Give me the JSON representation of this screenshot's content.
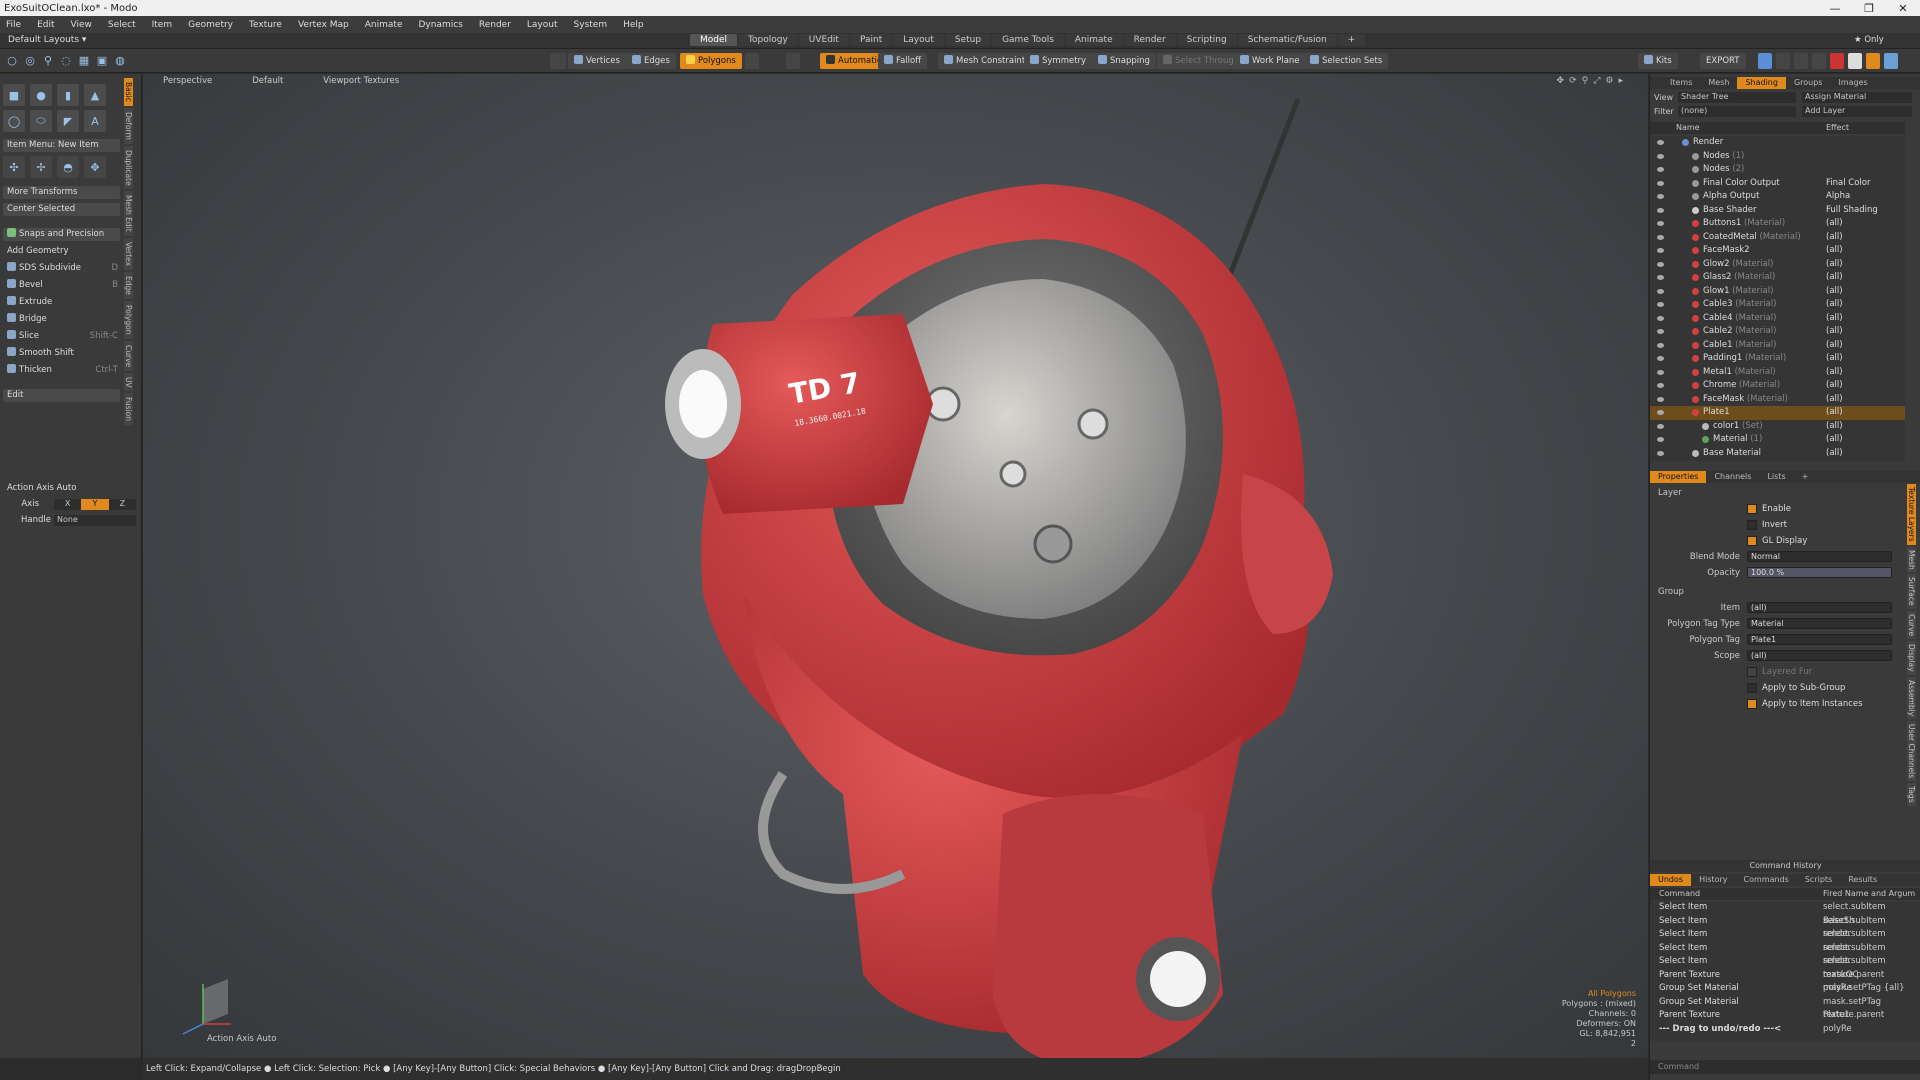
{
  "window": {
    "title": "ExoSuitOClean.lxo* - Modo",
    "controls": [
      "—",
      "❐",
      "✕"
    ]
  },
  "menu": [
    "File",
    "Edit",
    "View",
    "Select",
    "Item",
    "Geometry",
    "Texture",
    "Vertex Map",
    "Animate",
    "Dynamics",
    "Render",
    "Layout",
    "System",
    "Help"
  ],
  "layout": {
    "name": "Default Layouts ▾",
    "tabs": [
      "Model",
      "Topology",
      "UVEdit",
      "Paint",
      "Layout",
      "Setup",
      "Game Tools",
      "Animate",
      "Render",
      "Scripting",
      "Schematic/Fusion"
    ],
    "active": "Model",
    "plus": "+",
    "only_label": "★ Only"
  },
  "toolbar": {
    "vertices": "Vertices",
    "edges": "Edges",
    "polygons": "Polygons",
    "automatic": "Automatic",
    "falloff": "Falloff",
    "mesh_constraint": "Mesh Constraint",
    "symmetry": "Symmetry",
    "snapping": "Snapping",
    "select_through": "Select Through",
    "work_plane": "Work Plane",
    "selection_sets": "Selection Sets",
    "kits": "Kits",
    "export": "EXPORT"
  },
  "left": {
    "item_menu": "Item Menu: New Item",
    "more_transforms": "More Transforms",
    "center_selected": "Center Selected",
    "snaps": "Snaps and Precision",
    "add_geometry": "Add Geometry",
    "tools": [
      {
        "label": "SDS Subdivide",
        "key": "D"
      },
      {
        "label": "Bevel",
        "key": "B"
      },
      {
        "label": "Extrude",
        "key": ""
      },
      {
        "label": "Bridge",
        "key": ""
      },
      {
        "label": "Slice",
        "key": "Shift-C"
      },
      {
        "label": "Smooth Shift",
        "key": ""
      },
      {
        "label": "Thicken",
        "key": "Ctrl-T"
      }
    ],
    "edit": "Edit",
    "action_axis": "Action Axis Auto",
    "axis_label": "Axis",
    "axis_x": "X",
    "axis_y": "Y",
    "axis_z": "Z",
    "handle_label": "Handle",
    "handle_value": "None",
    "vtabs": [
      "Basic",
      "Deform",
      "Duplicate",
      "Mesh Edit",
      "Vertex",
      "Edge",
      "Polygon",
      "Curve",
      "UV",
      "Fusion"
    ]
  },
  "viewport": {
    "perspective": "Perspective",
    "shading": "Default",
    "textures": "Viewport Textures",
    "axis_label": "Action Axis Auto",
    "label_td7": "TD 7",
    "label_serial": "18.3660.0021.18",
    "info": {
      "selection": "All Polygons",
      "polygons": "Polygons : (mixed)",
      "channels": "Channels: 0",
      "deformers": "Deformers: ON",
      "gl": "GL: 8,842,951",
      "page": "2"
    }
  },
  "status": "Left Click: Expand/Collapse ● Left Click: Selection: Pick ● [Any Key]-[Any Button] Click: Special Behaviors ● [Any Key]-[Any Button] Click and Drag: dragDropBegin",
  "right": {
    "tabs": [
      "Items",
      "Mesh",
      "Shading",
      "Groups",
      "Images"
    ],
    "active": "Shading",
    "view_label": "View",
    "view_value": "Shader Tree",
    "assign": "Assign Material",
    "filter_label": "Filter",
    "filter_value": "(none)",
    "add_layer": "Add Layer",
    "col_name": "Name",
    "col_effect": "Effect",
    "tree": [
      {
        "name": "Render",
        "type": "",
        "effect": "",
        "indent": 0,
        "dot": "#6f8fcf"
      },
      {
        "name": "Nodes",
        "type": "(1)",
        "effect": "",
        "indent": 1,
        "dot": "#999"
      },
      {
        "name": "Nodes",
        "type": "(2)",
        "effect": "",
        "indent": 1,
        "dot": "#999"
      },
      {
        "name": "Final Color Output",
        "type": "",
        "effect": "Final Color",
        "indent": 1,
        "dot": "#999"
      },
      {
        "name": "Alpha Output",
        "type": "",
        "effect": "Alpha",
        "indent": 1,
        "dot": "#999"
      },
      {
        "name": "Base Shader",
        "type": "",
        "effect": "Full Shading",
        "indent": 1,
        "dot": "#ccc"
      },
      {
        "name": "Buttons1",
        "type": "(Material)",
        "effect": "(all)",
        "indent": 1,
        "dot": "#d24040"
      },
      {
        "name": "CoatedMetal",
        "type": "(Material)",
        "effect": "(all)",
        "indent": 1,
        "dot": "#d24040"
      },
      {
        "name": "FaceMask2",
        "type": "",
        "effect": "(all)",
        "indent": 1,
        "dot": "#d24040"
      },
      {
        "name": "Glow2",
        "type": "(Material)",
        "effect": "(all)",
        "indent": 1,
        "dot": "#d24040"
      },
      {
        "name": "Glass2",
        "type": "(Material)",
        "effect": "(all)",
        "indent": 1,
        "dot": "#d24040"
      },
      {
        "name": "Glow1",
        "type": "(Material)",
        "effect": "(all)",
        "indent": 1,
        "dot": "#d24040"
      },
      {
        "name": "Cable3",
        "type": "(Material)",
        "effect": "(all)",
        "indent": 1,
        "dot": "#d24040"
      },
      {
        "name": "Cable4",
        "type": "(Material)",
        "effect": "(all)",
        "indent": 1,
        "dot": "#d24040"
      },
      {
        "name": "Cable2",
        "type": "(Material)",
        "effect": "(all)",
        "indent": 1,
        "dot": "#d24040"
      },
      {
        "name": "Cable1",
        "type": "(Material)",
        "effect": "(all)",
        "indent": 1,
        "dot": "#d24040"
      },
      {
        "name": "Padding1",
        "type": "(Material)",
        "effect": "(all)",
        "indent": 1,
        "dot": "#d24040"
      },
      {
        "name": "Metal1",
        "type": "(Material)",
        "effect": "(all)",
        "indent": 1,
        "dot": "#d24040"
      },
      {
        "name": "Chrome",
        "type": "(Material)",
        "effect": "(all)",
        "indent": 1,
        "dot": "#d24040"
      },
      {
        "name": "FaceMask",
        "type": "(Material)",
        "effect": "(all)",
        "indent": 1,
        "dot": "#d24040"
      },
      {
        "name": "Plate1",
        "type": "",
        "effect": "(all)",
        "indent": 1,
        "dot": "#d24040",
        "selected": true
      },
      {
        "name": "color1",
        "type": "(Set)",
        "effect": "(all)",
        "indent": 2,
        "dot": "#bbb"
      },
      {
        "name": "Material",
        "type": "(1)",
        "effect": "(all)",
        "indent": 2,
        "dot": "#5aa55a"
      },
      {
        "name": "Base Material",
        "type": "",
        "effect": "(all)",
        "indent": 1,
        "dot": "#bbb"
      }
    ],
    "props_tabs": [
      "Properties",
      "Channels",
      "Lists",
      "+"
    ],
    "layer_section": "Layer",
    "enable": "Enable",
    "invert": "Invert",
    "gl_display": "GL Display",
    "blend_label": "Blend Mode",
    "blend_value": "Normal",
    "opacity_label": "Opacity",
    "opacity_value": "100.0 %",
    "group_section": "Group",
    "item_label": "Item",
    "item_value": "(all)",
    "ptt_label": "Polygon Tag Type",
    "ptt_value": "Material",
    "pt_label": "Polygon Tag",
    "pt_value": "Plate1",
    "scope_label": "Scope",
    "scope_value": "(all)",
    "layered_fur": "Layered Fur",
    "apply_sub": "Apply to Sub-Group",
    "apply_inst": "Apply to Item Instances",
    "side_tabs": [
      "Texture Layers",
      "Mesh",
      "Surface",
      "Curve",
      "Display",
      "Assembly",
      "User Channels",
      "Tags"
    ],
    "cmd_title": "Command History",
    "cmd_tabs": [
      "Undos",
      "History",
      "Commands",
      "Scripts",
      "Results"
    ],
    "cmd_col1": "Command",
    "cmd_col2": "Fired Name and Argum",
    "commands": [
      {
        "c": "Select Item",
        "a": "select.subItem BaseSh"
      },
      {
        "c": "Select Item",
        "a": "select.subItem render"
      },
      {
        "c": "Select Item",
        "a": "select.subItem render"
      },
      {
        "c": "Select Item",
        "a": "select.subItem render"
      },
      {
        "c": "Select Item",
        "a": "select.subItem maskOC"
      },
      {
        "c": "Parent Texture",
        "a": "texture.parent polyRe"
      },
      {
        "c": "Group Set Material",
        "a": "mask.setPTag {all}"
      },
      {
        "c": "Group Set Material",
        "a": "mask.setPTag Plate1"
      },
      {
        "c": "Parent Texture",
        "a": "texture.parent polyRe"
      }
    ],
    "drag_hint": "--- Drag to undo/redo ---<",
    "command_input": "Command"
  }
}
